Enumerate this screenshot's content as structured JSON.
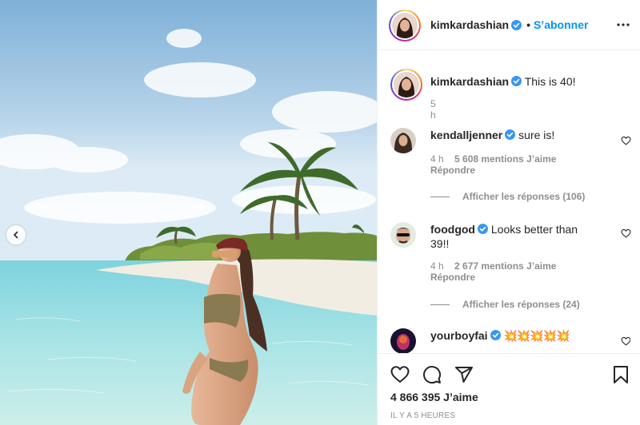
{
  "author": {
    "username": "kimkardashian",
    "follow_separator": "•",
    "follow_label": "S’abonner",
    "verified_icon": "verified-badge-icon"
  },
  "caption": {
    "username": "kimkardashian",
    "text": "This is 40!",
    "time": "5 h"
  },
  "comments": [
    {
      "username": "kendalljenner",
      "verified": true,
      "text": "sure is!",
      "time": "4 h",
      "likes": "5 608 mentions J’aime",
      "reply_label": "Répondre",
      "view_replies": "Afficher les réponses (106)"
    },
    {
      "username": "foodgod",
      "verified": true,
      "text": "Looks better than 39!!",
      "time": "4 h",
      "likes": "2 677 mentions J’aime",
      "reply_label": "Répondre",
      "view_replies": "Afficher les réponses (24)"
    },
    {
      "username": "yourboyfai",
      "verified": true,
      "text": "💥💥💥💥💥"
    }
  ],
  "footer": {
    "likes": "4 866 395 J’aime",
    "time": "IL Y A 5 HEURES"
  },
  "icons": {
    "like": "heart-icon",
    "comment": "comment-icon",
    "share": "share-icon",
    "save": "bookmark-icon",
    "more": "more-icon",
    "prev": "chevron-left-icon"
  },
  "colors": {
    "accent": "#0095f6",
    "verified": "#3897f0",
    "muted": "#8e8e8e",
    "text": "#262626"
  }
}
